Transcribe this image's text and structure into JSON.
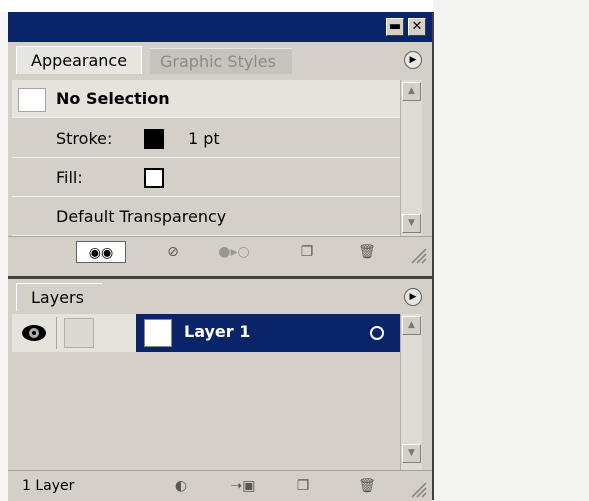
{
  "appearance_panel": {
    "tabs": [
      {
        "label": "Appearance",
        "active": true
      },
      {
        "label": "Graphic Styles",
        "active": false
      }
    ],
    "selection_label": "No Selection",
    "stroke": {
      "label": "Stroke:",
      "value": "1 pt",
      "color": "#000000"
    },
    "fill": {
      "label": "Fill:",
      "color": "#ffffff"
    },
    "transparency_label": "Default Transparency",
    "footer_icons": [
      "new-art-maintains-appearance-icon",
      "clear-appearance-icon",
      "reduce-to-basic-appearance-icon",
      "duplicate-item-icon",
      "delete-item-icon"
    ]
  },
  "layers_panel": {
    "tab_label": "Layers",
    "layers": [
      {
        "name": "Layer 1",
        "visible": true,
        "locked": false,
        "selected": true
      }
    ],
    "layer_count": "1 Layer",
    "footer_icons": [
      "make-clipping-mask-icon",
      "create-new-sublayer-icon",
      "create-new-layer-icon",
      "delete-layer-icon"
    ]
  },
  "colors": {
    "titlebar": "#0a246a",
    "selection": "#0a246a",
    "panel": "#d4d0c8"
  }
}
